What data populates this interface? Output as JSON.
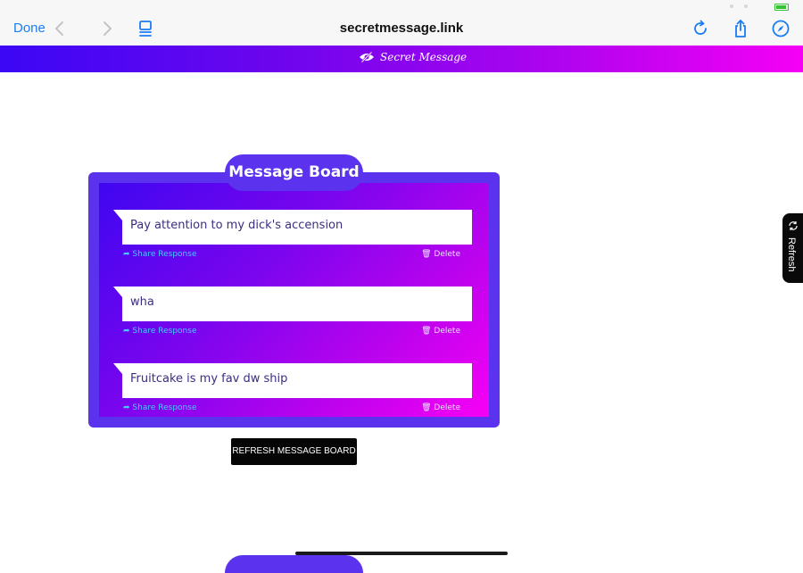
{
  "browser": {
    "done_label": "Done",
    "url": "secretmessage.link"
  },
  "site": {
    "brand_name": "Secret Message",
    "brand_colors": [
      "#3b07f5",
      "#f500f5"
    ]
  },
  "board": {
    "title": "Message Board",
    "messages": [
      {
        "text": "Pay attention to my dick's accension",
        "share_label": "Share Response",
        "delete_label": "Delete"
      },
      {
        "text": "wha",
        "share_label": "Share Response",
        "delete_label": "Delete"
      },
      {
        "text": "Fruitcake is my fav dw ship",
        "share_label": "Share Response",
        "delete_label": "Delete"
      }
    ],
    "refresh_label": "REFRESH MESSAGE BOARD"
  },
  "side_tab": {
    "label": "Refresh"
  },
  "icons": {
    "back": "chevron-left-icon",
    "forward": "chevron-right-icon",
    "reader": "reader-icon",
    "reload": "reload-icon",
    "share": "share-icon",
    "compass": "compass-icon"
  }
}
